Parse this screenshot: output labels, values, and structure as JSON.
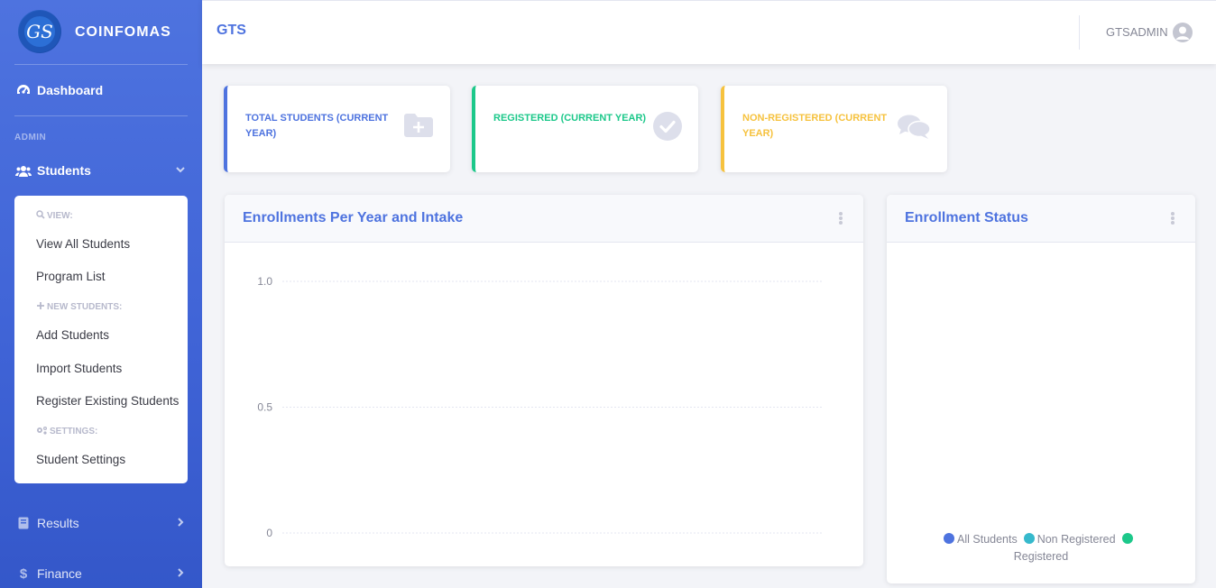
{
  "brand": {
    "name": "COINFOMAS",
    "logo_text": "GS"
  },
  "sidebar": {
    "dashboard": "Dashboard",
    "section_admin": "ADMIN",
    "students": "Students",
    "submenu": {
      "view_header": "VIEW:",
      "view_all": "View All Students",
      "program_list": "Program List",
      "new_header": "NEW STUDENTS:",
      "add": "Add Students",
      "import": "Import Students",
      "register_existing": "Register Existing Students",
      "settings_header": "SETTINGS:",
      "student_settings": "Student Settings"
    },
    "results": "Results",
    "finance": "Finance"
  },
  "topbar": {
    "title": "GTS",
    "user": "GTSADMIN"
  },
  "stats": [
    {
      "label": "TOTAL STUDENTS (CURRENT YEAR)",
      "color": "#4e73df",
      "icon": "folder-plus-icon"
    },
    {
      "label": "REGISTERED (CURRENT YEAR)",
      "color": "#1cc88a",
      "icon": "check-circle-icon"
    },
    {
      "label": "NON-REGISTERED (CURRENT YEAR)",
      "color": "#f6c23e",
      "icon": "comments-icon"
    }
  ],
  "enrollment_card": {
    "title": "Enrollments Per Year and Intake"
  },
  "status_card": {
    "title": "Enrollment Status"
  },
  "chart_data": [
    {
      "type": "line",
      "title": "Enrollments Per Year and Intake",
      "y_ticks": [
        "1.0",
        "0.5",
        "0"
      ],
      "ylim": [
        0,
        1
      ],
      "series": [],
      "grid": true
    },
    {
      "type": "pie",
      "title": "Enrollment Status",
      "legend": [
        {
          "label": "All Students",
          "color": "#4e73df"
        },
        {
          "label": "Non Registered",
          "color": "#36b9cc"
        },
        {
          "label": "Registered",
          "color": "#1cc88a"
        }
      ],
      "values": []
    }
  ]
}
